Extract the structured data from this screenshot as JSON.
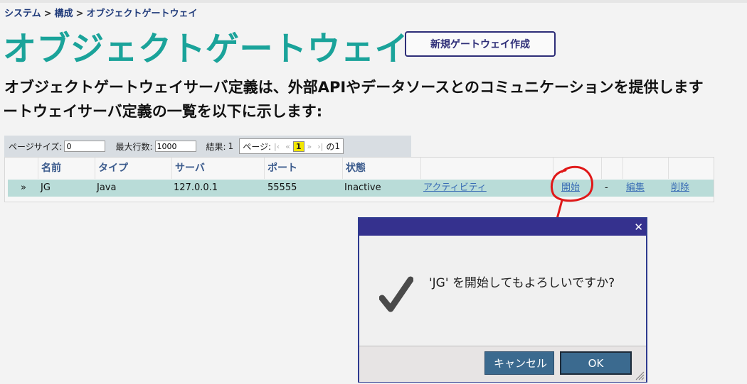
{
  "breadcrumb": [
    "システム",
    "構成",
    "オブジェクトゲートウェイ"
  ],
  "breadcrumb_sep": ">",
  "title": "オブジェクトゲートウェイ",
  "new_button": "新規ゲートウェイ作成",
  "description": {
    "line1": "オブジェクトゲートウェイサーバ定義は、外部APIやデータソースとのコミュニケーションを提供します",
    "line2": "ートウェイサーバ定義の一覧を以下に示します:"
  },
  "pager": {
    "page_size_label": "ページサイズ:",
    "page_size_value": "0",
    "max_rows_label": "最大行数:",
    "max_rows_value": "1000",
    "results_label": "結果:",
    "results_value": "1",
    "page_label": "ページ:",
    "first": "|‹",
    "prev": "«",
    "current": "1",
    "next": "»",
    "last": "›|",
    "of_label": "の",
    "total_pages": "1"
  },
  "table": {
    "headers": [
      "名前",
      "タイプ",
      "サーバ",
      "ポート",
      "状態"
    ],
    "row": {
      "expand": "»",
      "name": "JG",
      "type": "Java",
      "server": "127.0.0.1",
      "port": "55555",
      "status": "Inactive",
      "activity": "アクティビティ",
      "start": "開始",
      "dash": "-",
      "edit": "編集",
      "delete": "削除"
    }
  },
  "dialog": {
    "close": "✕",
    "message": "'JG' を開始してもよろしいですか?",
    "cancel": "キャンセル",
    "ok": "OK"
  },
  "colors": {
    "title": "#1aa39a",
    "row_highlight": "#b9dcd8",
    "dialog_titlebar": "#35318e",
    "button": "#3b6a8f",
    "annotation": "#e01818"
  },
  "icons": [
    "check-icon",
    "close-icon",
    "resize-grip-icon"
  ]
}
